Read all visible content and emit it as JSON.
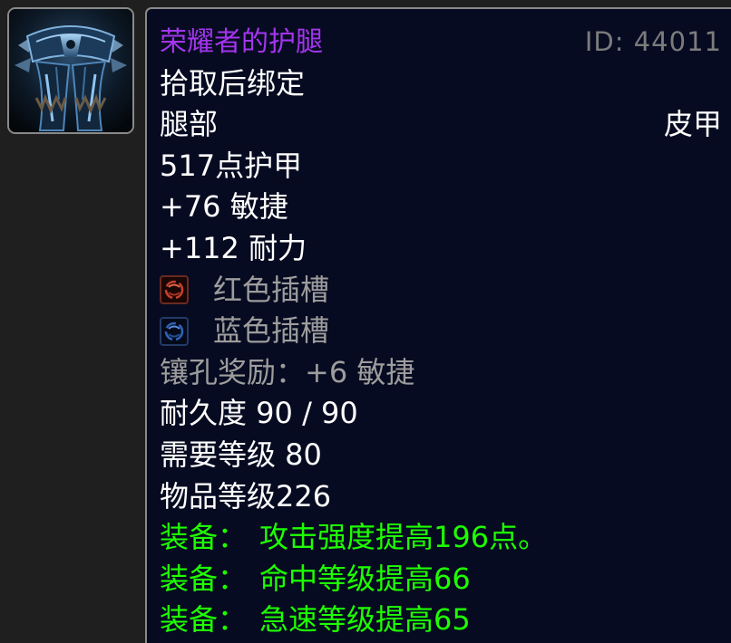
{
  "item": {
    "icon": "leggings-icon",
    "name": "荣耀者的护腿",
    "id_label": "ID: 44011",
    "binding": "拾取后绑定",
    "slot": "腿部",
    "armor_type": "皮甲",
    "armor": "517点护甲",
    "stats": [
      "+76 敏捷",
      "+112 耐力"
    ],
    "sockets": [
      {
        "icon": "red-socket-icon",
        "color": "#c8402e",
        "label": "红色插槽"
      },
      {
        "icon": "blue-socket-icon",
        "color": "#2f64b8",
        "label": "蓝色插槽"
      }
    ],
    "socket_bonus": "镶孔奖励：+6 敏捷",
    "durability": "耐久度 90 / 90",
    "required_level": "需要等级 80",
    "item_level": "物品等级226",
    "equip_effects": [
      {
        "prefix": "装备：",
        "text": "攻击强度提高196点。"
      },
      {
        "prefix": "装备：",
        "text": "命中等级提高66"
      },
      {
        "prefix": "装备：",
        "text": "急速等级提高65"
      }
    ]
  },
  "colors": {
    "item_name": "#a335ee",
    "id_text": "#7c7c7c",
    "normal_text": "#ffffff",
    "inactive_text": "#9d9d9d",
    "equip_text": "#1eff00",
    "tooltip_background": "#070b21",
    "page_background": "#1f1f1f",
    "border": "#8a8a8a"
  }
}
